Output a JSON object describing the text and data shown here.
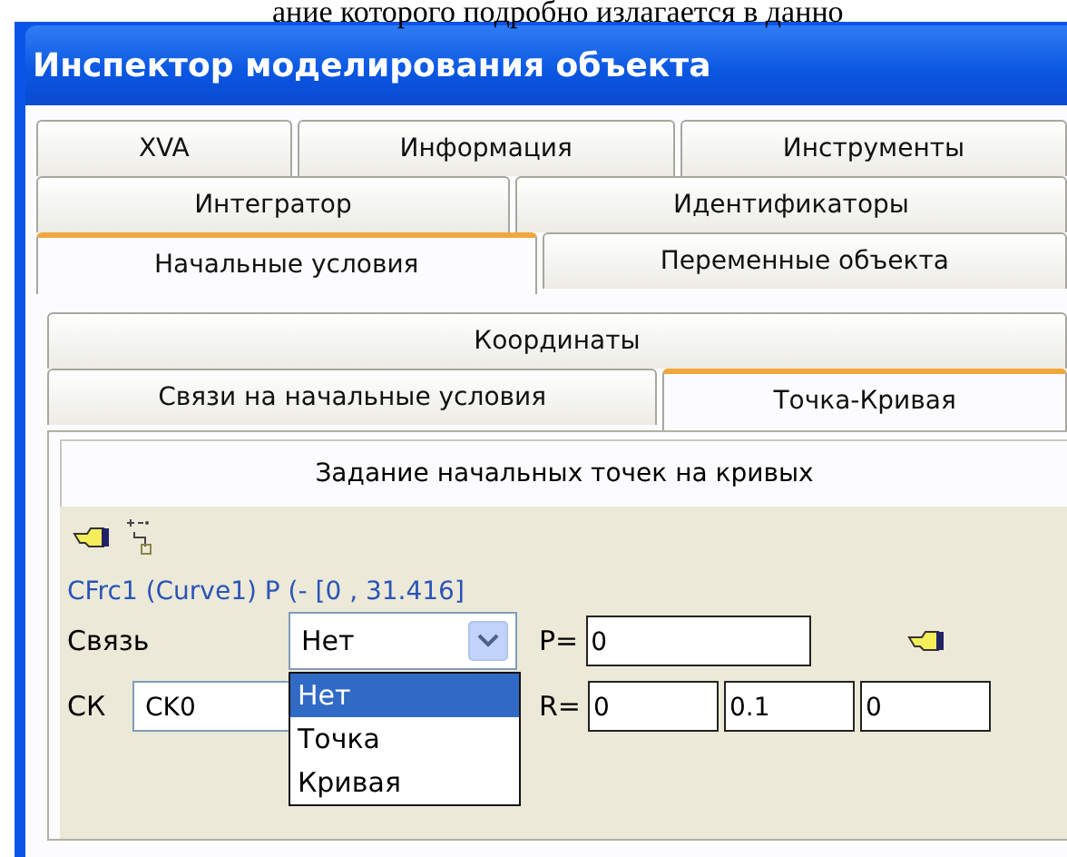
{
  "page_text": "ание которого подробно излагается в данно",
  "window": {
    "title": "Инспектор моделирования объекта"
  },
  "tab_rows": [
    [
      {
        "label": "XVA",
        "selected": false
      },
      {
        "label": "Информация",
        "selected": false
      },
      {
        "label": "Инструменты",
        "selected": false
      }
    ],
    [
      {
        "label": "Интегратор",
        "selected": false
      },
      {
        "label": "Идентификаторы",
        "selected": false
      }
    ],
    [
      {
        "label": "Начальные условия",
        "selected": true
      },
      {
        "label": "Переменные объекта",
        "selected": false
      }
    ]
  ],
  "subtab_rows": [
    [
      {
        "label": "Координаты",
        "selected": false
      }
    ],
    [
      {
        "label": "Связи на начальные условия",
        "selected": false
      },
      {
        "label": "Точка-Кривая",
        "selected": true
      }
    ]
  ],
  "panel": {
    "header": "Задание начальных точек на кривых",
    "group": {
      "legend": "CFrc1 (Curve1)  P (- [0 , 31.416]",
      "link_label": "Связь",
      "link_value": "Нет",
      "p_label": "P=",
      "p_value": "0",
      "ck_label": "СК",
      "ck_value": "CK0",
      "r_label": "R=",
      "r_values": [
        "0",
        "0.1",
        "0"
      ],
      "dropdown": [
        {
          "label": "Нет",
          "selected": true
        },
        {
          "label": "Точка",
          "selected": false
        },
        {
          "label": "Кривая",
          "selected": false
        }
      ]
    }
  }
}
